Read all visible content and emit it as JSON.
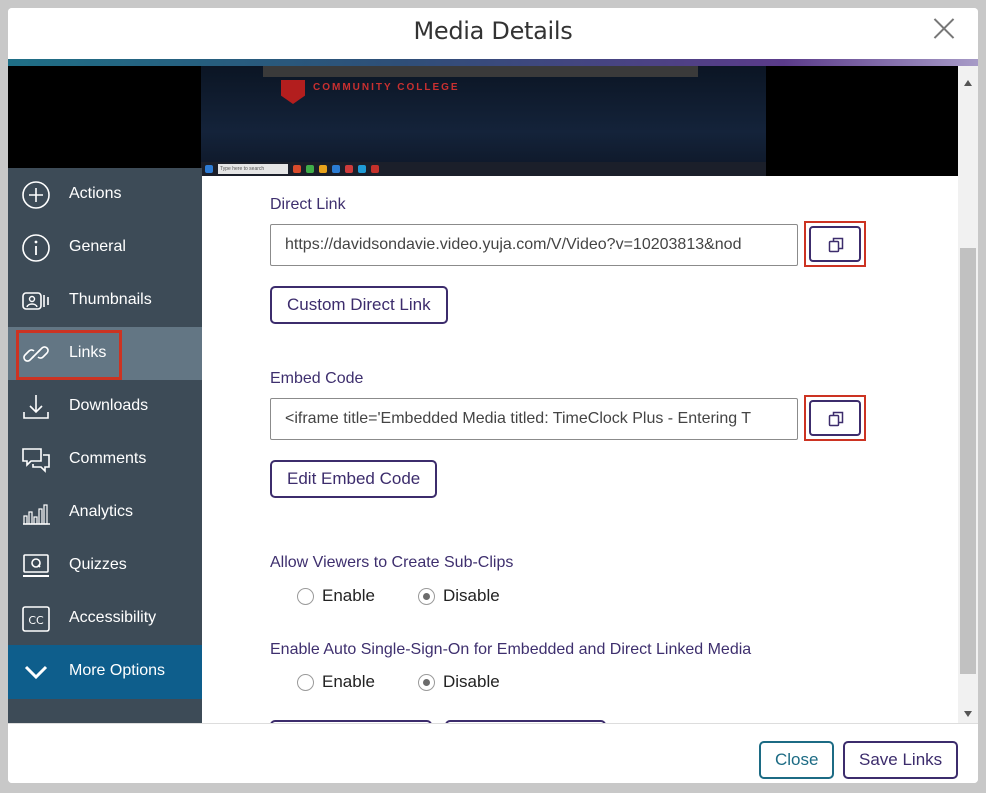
{
  "modal": {
    "title": "Media Details"
  },
  "video": {
    "college_text": "COMMUNITY COLLEGE",
    "taskbar_search": "Type here to search"
  },
  "sidebar": {
    "items": [
      {
        "label": "Actions",
        "icon": "plus-circle-icon"
      },
      {
        "label": "General",
        "icon": "info-circle-icon"
      },
      {
        "label": "Thumbnails",
        "icon": "thumbnails-icon"
      },
      {
        "label": "Links",
        "icon": "link-icon",
        "active": true
      },
      {
        "label": "Downloads",
        "icon": "download-icon"
      },
      {
        "label": "Comments",
        "icon": "comments-icon"
      },
      {
        "label": "Analytics",
        "icon": "analytics-icon"
      },
      {
        "label": "Quizzes",
        "icon": "quizzes-icon"
      },
      {
        "label": "Accessibility",
        "icon": "cc-icon"
      }
    ],
    "more_options": "More Options"
  },
  "links": {
    "direct_link_label": "Direct Link",
    "direct_link_value": "https://davidsondavie.video.yuja.com/V/Video?v=10203813&nod",
    "custom_direct_link_button": "Custom Direct Link",
    "embed_code_label": "Embed Code",
    "embed_code_value": "<iframe title='Embedded Media titled: TimeClock Plus - Entering T",
    "edit_embed_code_button": "Edit Embed Code",
    "subclips_label": "Allow Viewers to Create Sub-Clips",
    "sso_label": "Enable Auto Single-Sign-On for Embedded and Direct Linked Media",
    "enable_label": "Enable",
    "disable_label": "Disable",
    "subclips_selected": "Disable",
    "sso_selected": "Disable"
  },
  "footer": {
    "close_button": "Close",
    "save_button": "Save Links"
  },
  "colors": {
    "accent": "#3c2c6c",
    "sidebar": "#3d4b57",
    "sidebar_active": "#637684",
    "more_options": "#0e5e8c",
    "highlight": "#cc3322",
    "close_border": "#1c6b84"
  }
}
